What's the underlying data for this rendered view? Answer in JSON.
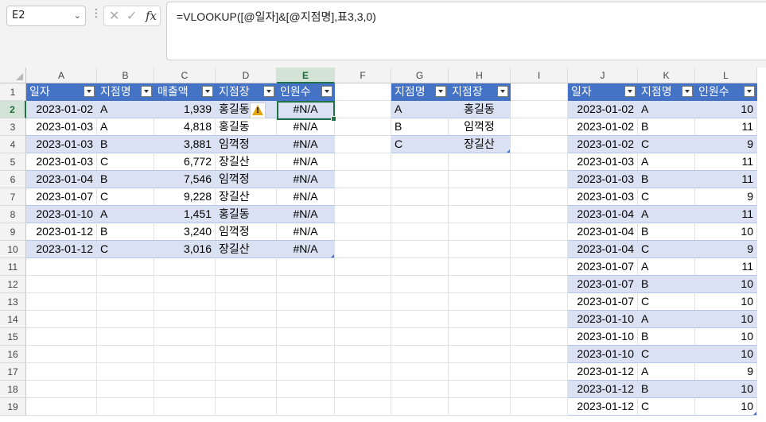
{
  "name_box": "E2",
  "formula_bar": {
    "fx_label": "fx",
    "formula": "=VLOOKUP([@일자]&[@지점명],표3,3,0)"
  },
  "columns": [
    "A",
    "B",
    "C",
    "D",
    "E",
    "F",
    "G",
    "H",
    "I",
    "J",
    "K",
    "L"
  ],
  "rows": [
    "1",
    "2",
    "3",
    "4",
    "5",
    "6",
    "7",
    "8",
    "9",
    "10",
    "11",
    "12",
    "13",
    "14",
    "15",
    "16",
    "17",
    "18",
    "19"
  ],
  "table1": {
    "headers": [
      "일자",
      "지점명",
      "매출액",
      "지점장",
      "인원수"
    ],
    "rows": [
      [
        "2023-01-02",
        "A",
        "1,939",
        "홍길동",
        "#N/A"
      ],
      [
        "2023-01-03",
        "A",
        "4,818",
        "홍길동",
        "#N/A"
      ],
      [
        "2023-01-03",
        "B",
        "3,881",
        "임꺽정",
        "#N/A"
      ],
      [
        "2023-01-03",
        "C",
        "6,772",
        "장길산",
        "#N/A"
      ],
      [
        "2023-01-04",
        "B",
        "7,546",
        "임꺽정",
        "#N/A"
      ],
      [
        "2023-01-07",
        "C",
        "9,228",
        "장길산",
        "#N/A"
      ],
      [
        "2023-01-10",
        "A",
        "1,451",
        "홍길동",
        "#N/A"
      ],
      [
        "2023-01-12",
        "B",
        "3,240",
        "임꺽정",
        "#N/A"
      ],
      [
        "2023-01-12",
        "C",
        "3,016",
        "장길산",
        "#N/A"
      ]
    ]
  },
  "table2": {
    "headers": [
      "지점명",
      "지점장"
    ],
    "rows": [
      [
        "A",
        "홍길동"
      ],
      [
        "B",
        "임꺽정"
      ],
      [
        "C",
        "장길산"
      ]
    ]
  },
  "table3": {
    "headers": [
      "일자",
      "지점명",
      "인원수"
    ],
    "rows": [
      [
        "2023-01-02",
        "A",
        "10"
      ],
      [
        "2023-01-02",
        "B",
        "11"
      ],
      [
        "2023-01-02",
        "C",
        "9"
      ],
      [
        "2023-01-03",
        "A",
        "11"
      ],
      [
        "2023-01-03",
        "B",
        "11"
      ],
      [
        "2023-01-03",
        "C",
        "9"
      ],
      [
        "2023-01-04",
        "A",
        "11"
      ],
      [
        "2023-01-04",
        "B",
        "10"
      ],
      [
        "2023-01-04",
        "C",
        "9"
      ],
      [
        "2023-01-07",
        "A",
        "11"
      ],
      [
        "2023-01-07",
        "B",
        "10"
      ],
      [
        "2023-01-07",
        "C",
        "10"
      ],
      [
        "2023-01-10",
        "A",
        "10"
      ],
      [
        "2023-01-10",
        "B",
        "10"
      ],
      [
        "2023-01-10",
        "C",
        "10"
      ],
      [
        "2023-01-12",
        "A",
        "9"
      ],
      [
        "2023-01-12",
        "B",
        "10"
      ],
      [
        "2023-01-12",
        "C",
        "10"
      ]
    ]
  },
  "colors": {
    "table_header": "#4472c4",
    "band": "#d9e1f2",
    "selection": "#217346"
  },
  "icons": {
    "warning": "warning-icon",
    "filter": "filter-dropdown-icon"
  }
}
